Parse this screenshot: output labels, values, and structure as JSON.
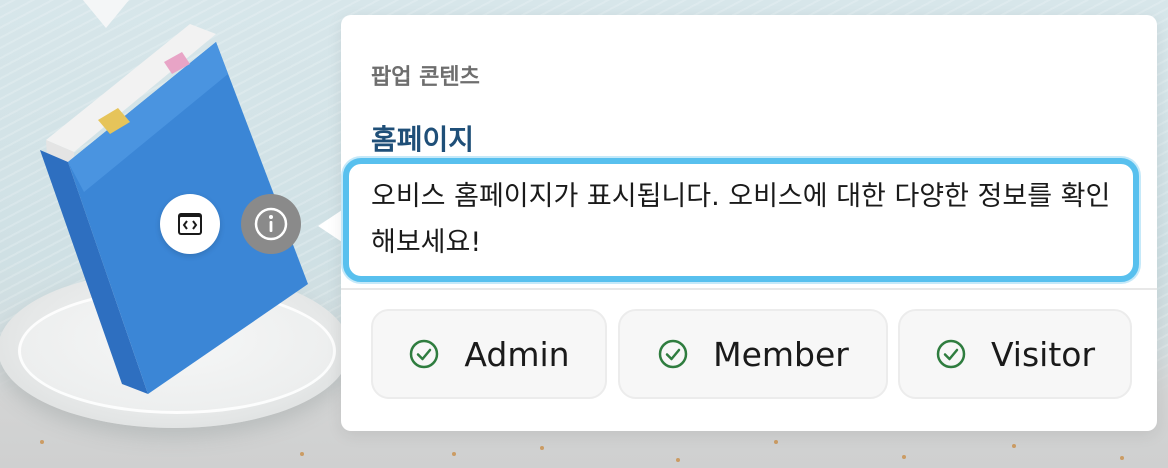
{
  "popup": {
    "title": "팝업 콘텐츠",
    "subtitle": "홈페이지",
    "description": "오비스 홈페이지가 표시됩니다. 오비스에 대한 다양한 정보를 확인해보세요!",
    "accent_color": "#58c0ee",
    "subtitle_color": "#1f4f78"
  },
  "icons": {
    "code_window": "code-window-icon",
    "info": "info-icon",
    "check": "check-circle-icon"
  },
  "roles": [
    {
      "label": "Admin"
    },
    {
      "label": "Member"
    },
    {
      "label": "Visitor"
    }
  ],
  "colors": {
    "check": "#2f7d3f",
    "book_blue": "#3b86d6",
    "info_button": "#8a8a8a"
  }
}
